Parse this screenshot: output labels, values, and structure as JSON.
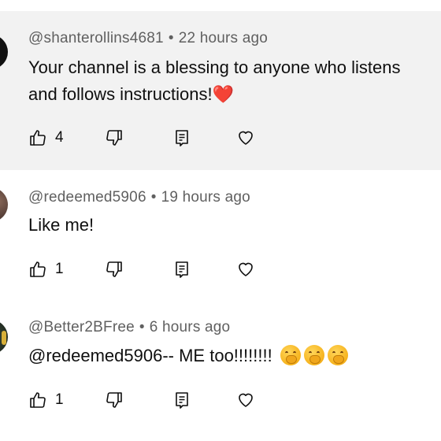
{
  "comments": [
    {
      "username": "@shanterollins4681",
      "separator": "•",
      "time": "22 hours ago",
      "line1": "Your channel is a blessing to anyone who listens",
      "line2": "and follows instructions!",
      "emoji": "❤️",
      "likes": "4"
    },
    {
      "username": "@redeemed5906",
      "separator": "•",
      "time": "19 hours ago",
      "line1": "Like me!",
      "likes": "1"
    },
    {
      "username": "@Better2BFree",
      "separator": "•",
      "time": "6 hours ago",
      "line1": "@redeemed5906-- ME too!!!!!!!!",
      "emojis": [
        "face-with-hand-over-mouth",
        "face-with-hand-over-mouth",
        "face-with-hand-over-mouth"
      ],
      "likes": "1"
    }
  ],
  "icons": {
    "like": "thumbs-up-icon",
    "dislike": "thumbs-down-icon",
    "reply": "reply-icon",
    "heart": "heart-icon"
  },
  "colors": {
    "highlight_bg": "#f2f2f2",
    "meta_text": "#606060",
    "heart_emoji": "#e8202a"
  }
}
